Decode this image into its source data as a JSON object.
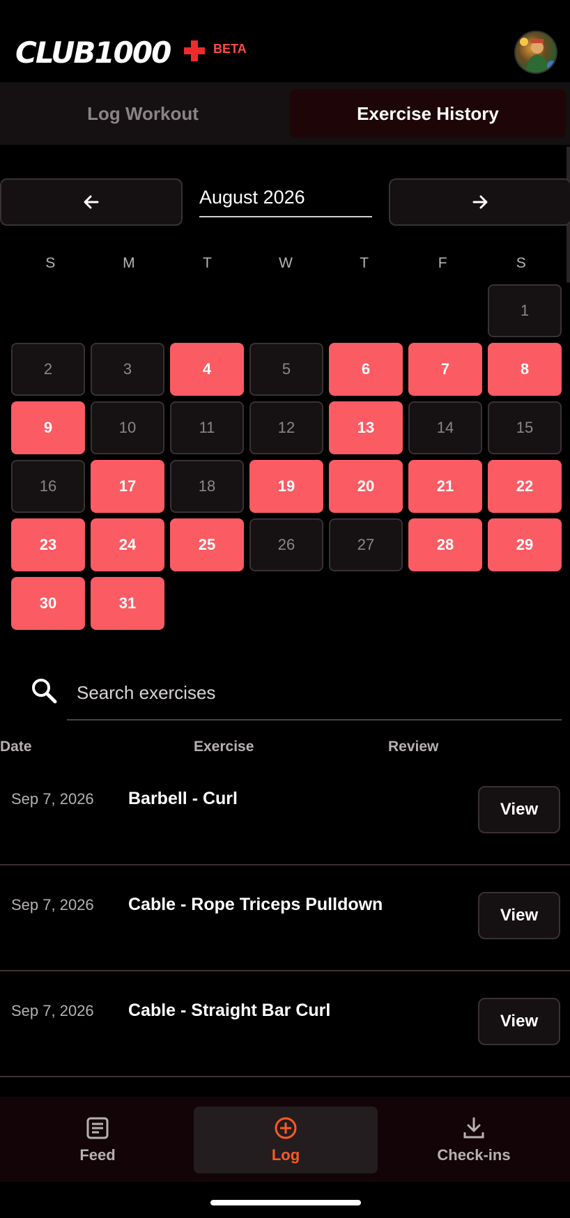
{
  "header": {
    "logo_text": "CLUB1000",
    "beta_label": "BETA",
    "avatar_icon": "user-avatar"
  },
  "tabs": [
    {
      "label": "Log Workout",
      "active": false
    },
    {
      "label": "Exercise History",
      "active": true
    }
  ],
  "calendar": {
    "month_label": "August 2026",
    "prev_icon": "arrow-left-icon",
    "next_icon": "arrow-right-icon",
    "weekdays": [
      "S",
      "M",
      "T",
      "W",
      "T",
      "F",
      "S"
    ],
    "first_weekday_index": 6,
    "days_in_month": 31,
    "active_days": [
      4,
      6,
      7,
      8,
      9,
      13,
      17,
      19,
      20,
      21,
      22,
      23,
      24,
      25,
      28,
      29,
      30,
      31
    ],
    "active_color": "#fb5b63"
  },
  "search": {
    "placeholder": "Search exercises"
  },
  "table": {
    "headers": {
      "date": "Date",
      "exercise": "Exercise",
      "review": "Review"
    },
    "rows": [
      {
        "date": "Sep 7, 2026",
        "exercise": "Barbell - Curl",
        "action": "View"
      },
      {
        "date": "Sep 7, 2026",
        "exercise": "Cable - Rope Triceps Pulldown",
        "action": "View"
      },
      {
        "date": "Sep 7, 2026",
        "exercise": "Cable - Straight Bar Curl",
        "action": "View"
      }
    ]
  },
  "bottom_nav": {
    "items": [
      {
        "label": "Feed",
        "icon": "feed-icon",
        "active": false
      },
      {
        "label": "Log",
        "icon": "plus-circle-icon",
        "active": true
      },
      {
        "label": "Check-ins",
        "icon": "download-icon",
        "active": false
      }
    ],
    "accent": "#ff5a25"
  }
}
